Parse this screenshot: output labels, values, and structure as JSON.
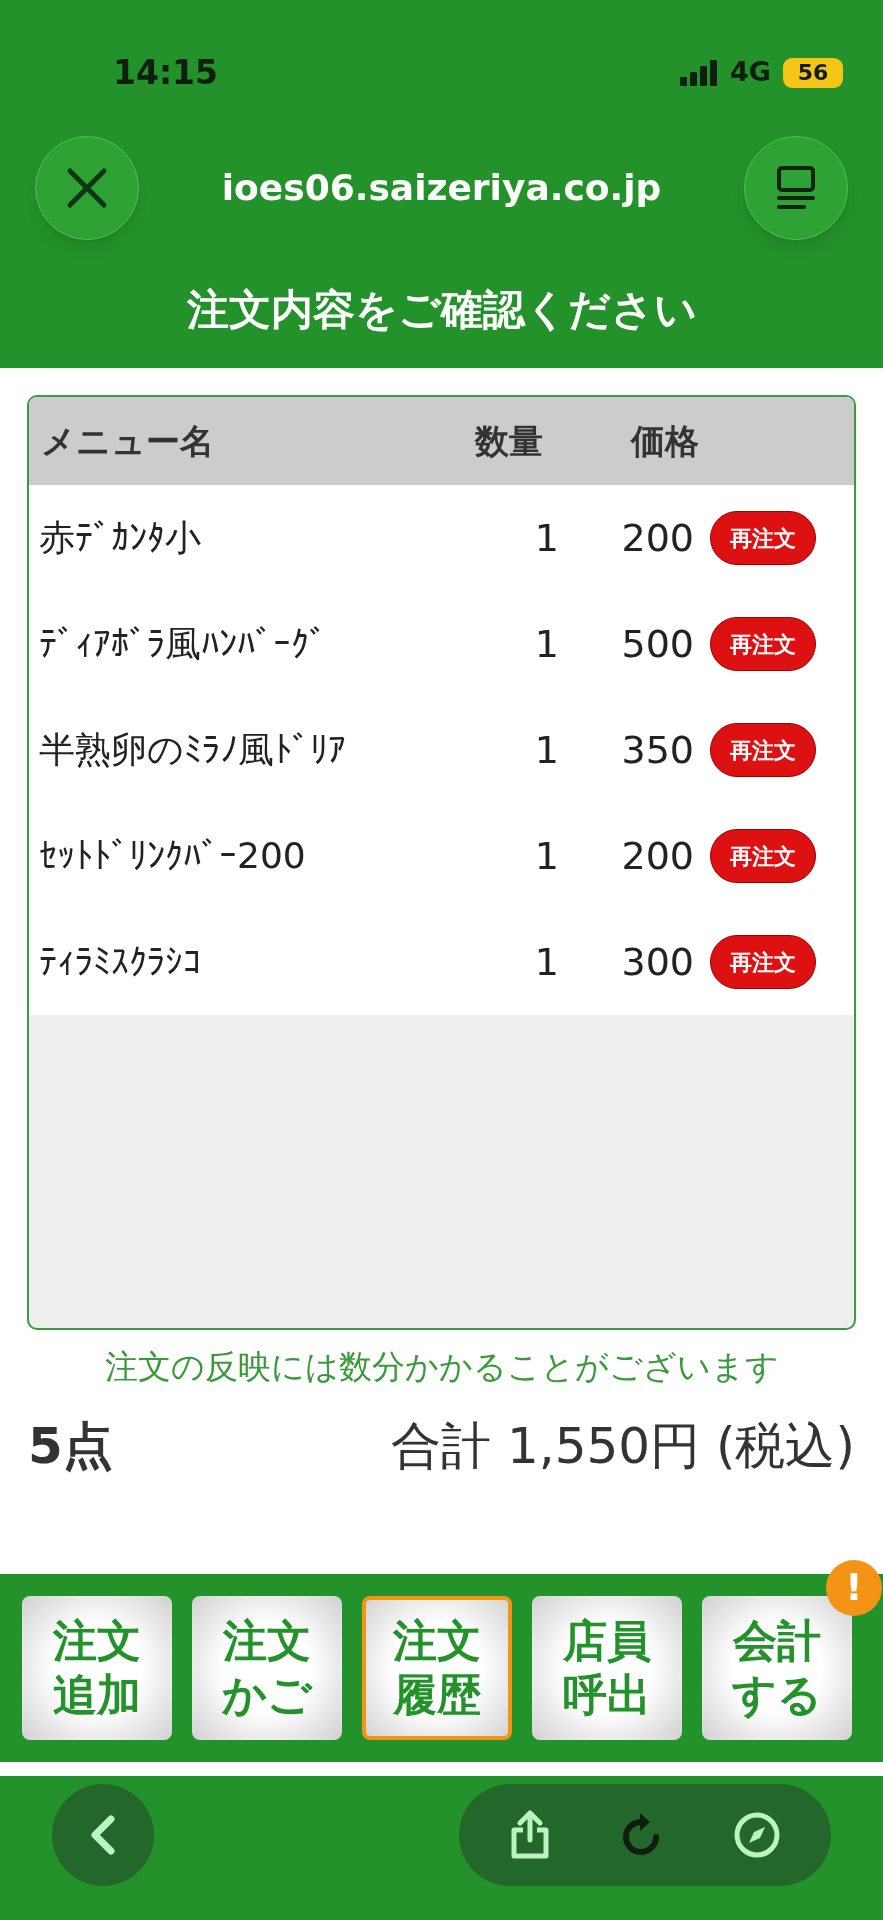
{
  "status_bar": {
    "time": "14:15",
    "network": "4G",
    "battery": "56"
  },
  "browser": {
    "url": "ioes06.saizeriya.co.jp"
  },
  "page_title": "注文内容をご確認ください",
  "table": {
    "columns": [
      "メニュー名",
      "数量",
      "価格"
    ],
    "rows": [
      {
        "name": "赤ﾃﾞｶﾝﾀ小",
        "quantity": "1",
        "price": "200",
        "action": "再注文"
      },
      {
        "name": "ﾃﾞｨｱﾎﾞﾗ風ﾊﾝﾊﾞｰｸﾞ",
        "quantity": "1",
        "price": "500",
        "action": "再注文"
      },
      {
        "name": "半熟卵のﾐﾗﾉ風ﾄﾞﾘｱ",
        "quantity": "1",
        "price": "350",
        "action": "再注文"
      },
      {
        "name": "ｾｯﾄﾄﾞﾘﾝｸﾊﾞｰ200",
        "quantity": "1",
        "price": "200",
        "action": "再注文"
      },
      {
        "name": "ﾃｨﾗﾐｽｸﾗｼｺ",
        "quantity": "1",
        "price": "300",
        "action": "再注文"
      }
    ]
  },
  "note": "注文の反映には数分かかることがございます",
  "summary": {
    "count": "5点",
    "total": "合計 1,550円 (税込)"
  },
  "nav_buttons": [
    {
      "lines": [
        "注文",
        "追加"
      ],
      "selected": false
    },
    {
      "lines": [
        "注文",
        "かご"
      ],
      "selected": false
    },
    {
      "lines": [
        "注文",
        "履歴"
      ],
      "selected": true
    },
    {
      "lines": [
        "店員",
        "呼出"
      ],
      "selected": false
    },
    {
      "lines": [
        "会計",
        "する"
      ],
      "selected": false,
      "badge": "!"
    }
  ]
}
